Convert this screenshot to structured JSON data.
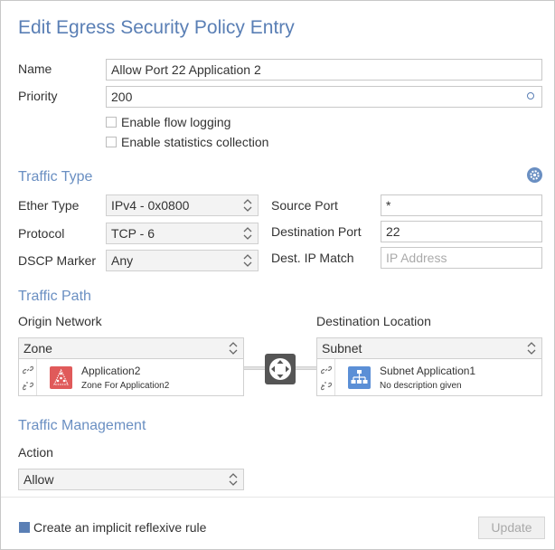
{
  "dialog": {
    "title": "Edit Egress Security Policy Entry"
  },
  "fields": {
    "name_label": "Name",
    "name_value": "Allow Port 22 Application 2",
    "priority_label": "Priority",
    "priority_value": "200",
    "flow_logging_label": "Enable flow logging",
    "flow_logging_checked": false,
    "stats_label": "Enable statistics collection",
    "stats_checked": false
  },
  "traffic_type": {
    "heading": "Traffic Type",
    "ether_type_label": "Ether Type",
    "ether_type_value": "IPv4 - 0x0800",
    "protocol_label": "Protocol",
    "protocol_value": "TCP - 6",
    "dscp_label": "DSCP Marker",
    "dscp_value": "Any",
    "source_port_label": "Source Port",
    "source_port_value": "*",
    "dest_port_label": "Destination Port",
    "dest_port_value": "22",
    "dest_ip_label": "Dest. IP Match",
    "dest_ip_placeholder": "IP Address"
  },
  "traffic_path": {
    "heading": "Traffic Path",
    "origin_label": "Origin Network",
    "origin_select": "Zone",
    "origin_card_title": "Application2",
    "origin_card_sub": "Zone For Application2",
    "destination_label": "Destination Location",
    "destination_select": "Subnet",
    "destination_card_title": "Subnet Application1",
    "destination_card_sub": "No description given"
  },
  "traffic_management": {
    "heading": "Traffic Management",
    "action_label": "Action",
    "action_value": "Allow"
  },
  "footer": {
    "reflexive_label": "Create an implicit reflexive rule",
    "reflexive_checked": true,
    "update_label": "Update"
  },
  "colors": {
    "accent": "#5a7fb5",
    "zone_icon_bg": "#e05a5a",
    "subnet_icon_bg": "#5b8fd6",
    "router_bg": "#555555"
  }
}
